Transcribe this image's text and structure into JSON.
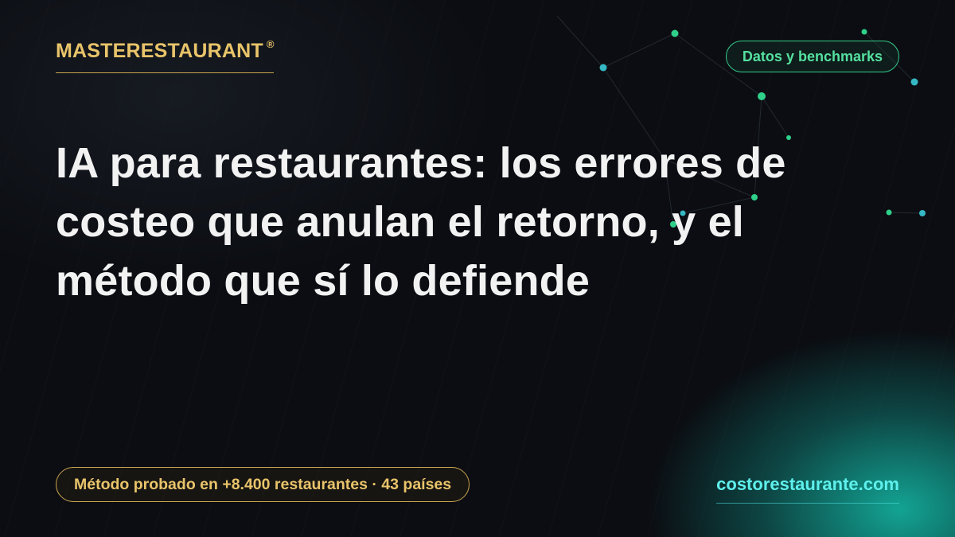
{
  "brand": {
    "name": "MASTERESTAURANT",
    "registered": "®"
  },
  "tag": {
    "label": "Datos y benchmarks"
  },
  "headline": "IA para restaurantes: los errores de costeo que anulan el retorno, y el método que sí lo defiende",
  "badge": {
    "label": "Método probado en +8.400 restaurantes · 43 países"
  },
  "site": {
    "url": "costorestaurante.com"
  },
  "colors": {
    "background": "#0b0d12",
    "brand_gold": "#e9c46a",
    "tag_green": "#55e0a0",
    "site_cyan": "#5ef0ec",
    "headline": "#f2f2f2"
  }
}
